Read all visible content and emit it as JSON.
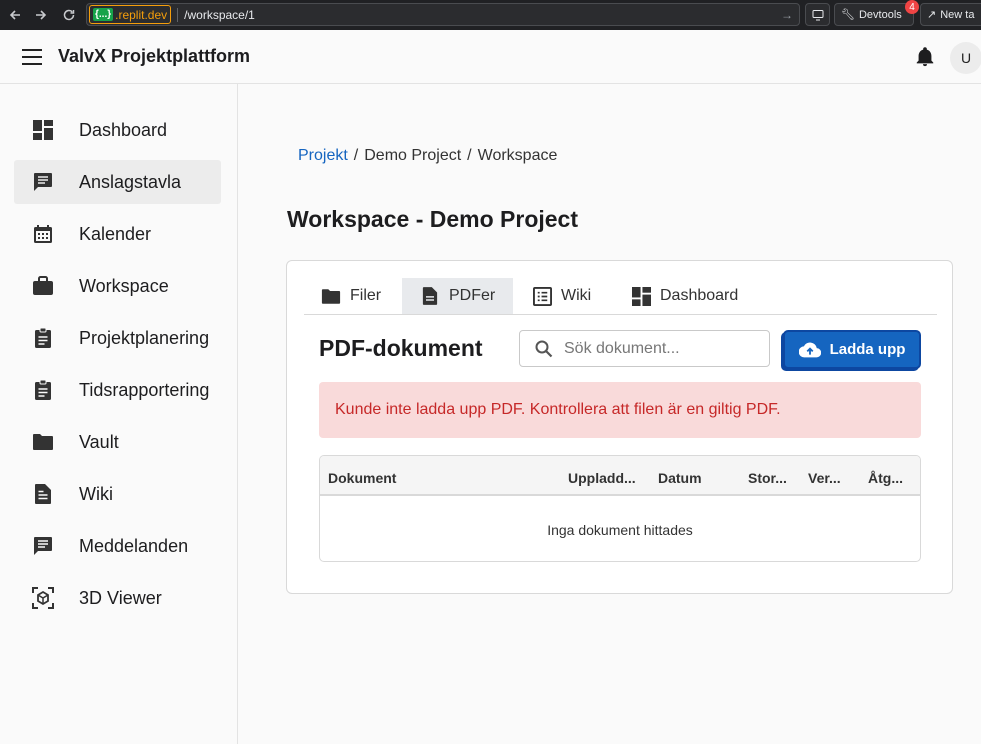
{
  "browser": {
    "domain_chip": "{...}",
    "domain": ".replit.dev",
    "path": "/workspace/1",
    "devtools_label": "Devtools",
    "devtools_badge": "4",
    "new_tab_label": "New ta"
  },
  "app": {
    "title": "ValvX Projektplattform",
    "avatar_initial": "U"
  },
  "sidebar": {
    "items": [
      {
        "label": "Dashboard",
        "icon": "dashboard-icon",
        "active": false
      },
      {
        "label": "Anslagstavla",
        "icon": "message-board-icon",
        "active": true
      },
      {
        "label": "Kalender",
        "icon": "calendar-icon",
        "active": false
      },
      {
        "label": "Workspace",
        "icon": "briefcase-icon",
        "active": false
      },
      {
        "label": "Projektplanering",
        "icon": "clipboard-icon",
        "active": false
      },
      {
        "label": "Tidsrapportering",
        "icon": "clipboard-icon",
        "active": false
      },
      {
        "label": "Vault",
        "icon": "folder-icon",
        "active": false
      },
      {
        "label": "Wiki",
        "icon": "document-icon",
        "active": false
      },
      {
        "label": "Meddelanden",
        "icon": "chat-icon",
        "active": false
      },
      {
        "label": "3D Viewer",
        "icon": "cube-icon",
        "active": false
      }
    ]
  },
  "breadcrumb": {
    "root": "Projekt",
    "sep": "/",
    "project": "Demo Project",
    "current": "Workspace"
  },
  "page": {
    "title": "Workspace - Demo Project"
  },
  "tabs": [
    {
      "label": "Filer",
      "icon": "folder-icon",
      "active": false
    },
    {
      "label": "PDFer",
      "icon": "pdf-file-icon",
      "active": true
    },
    {
      "label": "Wiki",
      "icon": "list-icon",
      "active": false
    },
    {
      "label": "Dashboard",
      "icon": "dashboard-icon",
      "active": false
    }
  ],
  "pdf": {
    "title": "PDF-dokument",
    "search_placeholder": "Sök dokument...",
    "upload_label": "Ladda upp",
    "error": "Kunde inte ladda upp PDF. Kontrollera att filen är en giltig PDF.",
    "columns": [
      "Dokument",
      "Uppladd...",
      "Datum",
      "Stor...",
      "Ver...",
      "Åtg..."
    ],
    "empty": "Inga dokument hittades"
  },
  "colors": {
    "accent": "#1565c0",
    "error_bg": "#f9dada",
    "error_text": "#c62828"
  }
}
